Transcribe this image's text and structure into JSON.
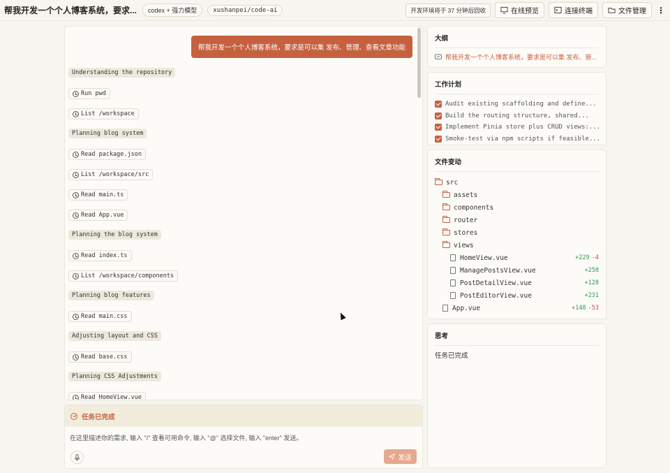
{
  "header": {
    "title": "帮我开发一个个人博客系统，要求...",
    "model_pill": "codex + 强力模型",
    "repo_pill": "xushanpei/code-ai",
    "env_notice": "开发环境将于 37 分钟后回收",
    "buttons": {
      "preview": "在线预览",
      "terminal": "连接终端",
      "files": "文件管理"
    }
  },
  "chat": {
    "user_message": "帮我开发一个个人博客系统，要求是可以集 发布、管理、查看文章功能",
    "steps": [
      {
        "kind": "plan",
        "text": "Understanding the repository"
      },
      {
        "kind": "act",
        "text": "Run pwd"
      },
      {
        "kind": "act",
        "text": "List /workspace"
      },
      {
        "kind": "plan",
        "text": "Planning blog system"
      },
      {
        "kind": "act",
        "text": "Read package.json"
      },
      {
        "kind": "act",
        "text": "List /workspace/src"
      },
      {
        "kind": "act",
        "text": "Read main.ts"
      },
      {
        "kind": "act",
        "text": "Read App.vue"
      },
      {
        "kind": "plan",
        "text": "Planning the blog system"
      },
      {
        "kind": "act",
        "text": "Read index.ts"
      },
      {
        "kind": "act",
        "text": "List /workspace/components"
      },
      {
        "kind": "plan",
        "text": "Planning blog features"
      },
      {
        "kind": "act",
        "text": "Read main.css"
      },
      {
        "kind": "plan",
        "text": "Adjusting layout and CSS"
      },
      {
        "kind": "act",
        "text": "Read base.css"
      },
      {
        "kind": "plan",
        "text": "Planning CSS Adjustments"
      },
      {
        "kind": "act",
        "text": "Read HomeView.vue"
      }
    ]
  },
  "input": {
    "status": "任务已完成",
    "placeholder": "在这里描述你的需求, 输入 \"/\" 查看可用命令, 输入 \"@\" 选择文件, 输入 \"enter\" 发送。",
    "send_label": "发送"
  },
  "outline": {
    "title": "大纲",
    "item": "帮我开发一个个人博客系统，要求是可以集 发布、管..."
  },
  "plan": {
    "title": "工作计划",
    "items": [
      "Audit existing scaffolding and define...",
      "Build the routing structure, shared...",
      "Implement Pinia store plus CRUD views:...",
      "Smoke-test via npm scripts if feasible..."
    ]
  },
  "files": {
    "title": "文件变动",
    "tree": [
      {
        "name": "src",
        "type": "folder",
        "depth": 0
      },
      {
        "name": "assets",
        "type": "folder",
        "depth": 1
      },
      {
        "name": "components",
        "type": "folder",
        "depth": 1
      },
      {
        "name": "router",
        "type": "folder",
        "depth": 1
      },
      {
        "name": "stores",
        "type": "folder",
        "depth": 1
      },
      {
        "name": "views",
        "type": "folder",
        "depth": 1
      },
      {
        "name": "HomeView.vue",
        "type": "file",
        "depth": 2,
        "add": "+229",
        "del": "-4"
      },
      {
        "name": "ManagePostsView.vue",
        "type": "file",
        "depth": 2,
        "add": "+258",
        "del": ""
      },
      {
        "name": "PostDetailView.vue",
        "type": "file",
        "depth": 2,
        "add": "+128",
        "del": ""
      },
      {
        "name": "PostEditorView.vue",
        "type": "file",
        "depth": 2,
        "add": "+231",
        "del": ""
      },
      {
        "name": "App.vue",
        "type": "file",
        "depth": 1,
        "add": "+148",
        "del": "-53"
      }
    ]
  },
  "thinking": {
    "title": "思考",
    "text": "任务已完成"
  }
}
